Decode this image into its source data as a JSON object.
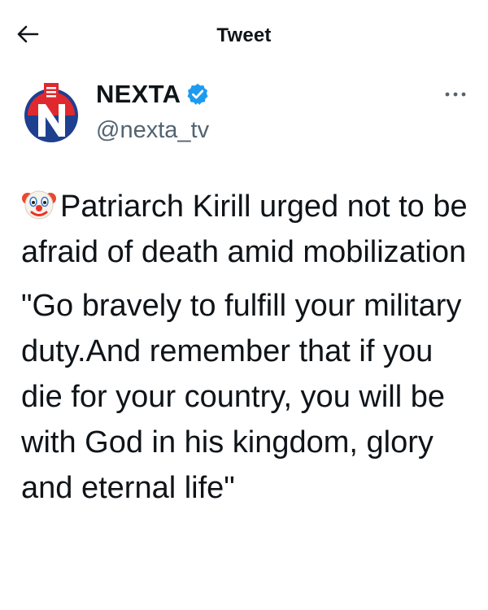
{
  "header": {
    "title": "Tweet",
    "back_icon": "arrow-left-icon"
  },
  "author": {
    "display_name": "NEXTA",
    "handle": "@nexta_tv",
    "verified": true,
    "avatar_icon": "nexta-logo",
    "more_icon": "more-horizontal-icon"
  },
  "tweet": {
    "emoji_icon": "clown-face-emoji",
    "paragraph1": "Patriarch Kirill urged not to be afraid of death amid mobilization",
    "paragraph2": "\"Go bravely to fulfill your military duty.And remember that if you die for your country, you will be with God in his kingdom, glory and eternal life\""
  },
  "colors": {
    "text": "#0f1419",
    "secondary": "#536471",
    "verified": "#1d9bf0",
    "brand_red": "#e0292e",
    "brand_blue": "#1f3f8f"
  }
}
